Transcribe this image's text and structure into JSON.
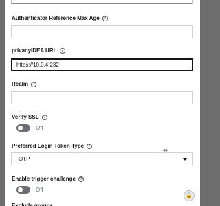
{
  "form": {
    "authenticator_reference_max_age": {
      "label": "Authenticator Reference Max Age",
      "value": ""
    },
    "privacyidea_url": {
      "label": "privacyIDEA URL",
      "value": "https://10.0.4.232"
    },
    "realm": {
      "label": "Realm",
      "value": ""
    },
    "verify_ssl": {
      "label": "Verify SSL",
      "state": "Off"
    },
    "preferred_login_token_type": {
      "label": "Preferred Login Token Type",
      "selected": "OTP"
    },
    "enable_trigger_challenge": {
      "label": "Enable trigger challenge",
      "state": "Off"
    },
    "next_label_partial": "Exclude groups"
  },
  "icons": {
    "help": "?",
    "move": "⇴",
    "extension": "🔒"
  }
}
